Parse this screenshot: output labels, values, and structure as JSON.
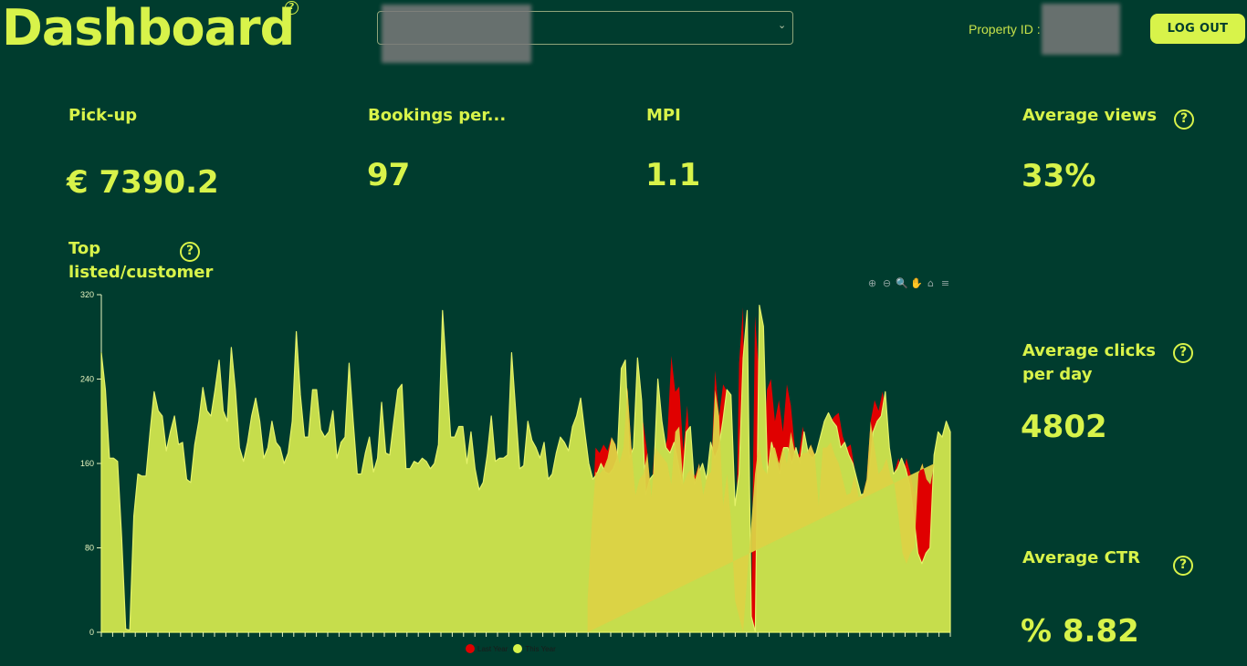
{
  "header": {
    "title": "Dashboard",
    "help_glyph": "?",
    "property_label": "Property ID :",
    "logout_label": "LOG OUT"
  },
  "kpis": [
    {
      "label": "Pick-up",
      "value": "€ 7390.2"
    },
    {
      "label": "Bookings per...",
      "value": "97"
    },
    {
      "label": "MPI",
      "value": "1.1"
    },
    {
      "label": "Average views",
      "value": "33%"
    },
    {
      "label": "Average clicks per day",
      "value": "4802"
    },
    {
      "label": "Average CTR",
      "value": "% 8.82"
    }
  ],
  "chart_title": "Top listed/customer",
  "toolbar": {
    "icons": [
      "zoom-in-icon",
      "zoom-out-icon",
      "zoom-selection-icon",
      "pan-hand-icon",
      "home-icon",
      "menu-icon"
    ]
  },
  "colors": {
    "background": "#003c2e",
    "accent": "#d8f34a",
    "last_year": "#e00000",
    "this_year": "#c6dd4c"
  },
  "chart_data": {
    "type": "area",
    "ylim": [
      0,
      320
    ],
    "yticks": [
      "0",
      "80",
      "160",
      "240",
      "320"
    ],
    "series": [
      {
        "name": "Last Year",
        "color": "#e00000",
        "values": [
          0,
          0,
          0,
          0,
          0,
          0,
          0,
          0,
          0,
          0,
          0,
          0,
          0,
          0,
          0,
          0,
          0,
          0,
          0,
          0,
          0,
          0,
          0,
          0,
          0,
          0,
          0,
          0,
          0,
          0,
          0,
          0,
          0,
          0,
          0,
          0,
          0,
          0,
          0,
          0,
          0,
          0,
          0,
          0,
          0,
          0,
          0,
          0,
          0,
          0,
          0,
          0,
          0,
          0,
          0,
          0,
          0,
          0,
          0,
          0,
          0,
          0,
          0,
          0,
          0,
          0,
          0,
          0,
          0,
          0,
          0,
          0,
          0,
          0,
          0,
          0,
          0,
          0,
          0,
          0,
          0,
          0,
          0,
          0,
          0,
          0,
          0,
          0,
          0,
          0,
          0,
          0,
          0,
          0,
          0,
          0,
          0,
          0,
          0,
          0,
          0,
          0,
          0,
          0,
          0,
          0,
          0,
          0,
          0,
          0,
          0,
          0,
          0,
          0,
          0,
          0,
          0,
          0,
          0,
          0,
          0,
          0,
          30,
          100,
          175,
          170,
          178,
          172,
          185,
          178,
          160,
          195,
          232,
          175,
          160,
          212,
          198,
          170,
          128,
          190,
          218,
          165,
          185,
          262,
          228,
          233,
          172,
          215,
          155,
          148,
          160,
          130,
          148,
          152,
          248,
          205,
          235,
          228,
          105,
          30,
          255,
          308,
          0,
          0,
          300,
          245,
          155,
          230,
          240,
          200,
          220,
          190,
          235,
          215,
          175,
          168,
          195,
          170,
          178,
          168,
          120,
          175,
          192,
          200,
          205,
          208,
          186,
          175,
          178,
          155,
          128,
          130,
          145,
          200,
          220,
          210,
          228,
          205,
          148,
          152,
          165,
          148,
          165,
          150,
          130,
          150,
          160,
          145,
          140,
          160,
          150,
          155,
          185,
          190
        ]
      },
      {
        "name": "This Year",
        "color": "#c6dd4c",
        "values": [
          265,
          230,
          165,
          165,
          162,
          90,
          3,
          2,
          110,
          150,
          148,
          148,
          190,
          228,
          210,
          205,
          172,
          190,
          205,
          178,
          180,
          145,
          142,
          178,
          200,
          232,
          210,
          205,
          230,
          258,
          210,
          200,
          270,
          230,
          175,
          162,
          180,
          205,
          222,
          200,
          165,
          175,
          200,
          180,
          175,
          160,
          170,
          200,
          285,
          225,
          185,
          185,
          230,
          230,
          192,
          185,
          190,
          210,
          165,
          180,
          185,
          255,
          200,
          150,
          150,
          170,
          185,
          152,
          165,
          218,
          170,
          168,
          200,
          230,
          235,
          155,
          155,
          162,
          160,
          165,
          162,
          155,
          160,
          178,
          305,
          245,
          185,
          185,
          195,
          195,
          160,
          190,
          155,
          135,
          142,
          168,
          205,
          162,
          165,
          165,
          168,
          265,
          210,
          155,
          158,
          200,
          182,
          175,
          165,
          180,
          145,
          150,
          170,
          185,
          180,
          172,
          195,
          205,
          222,
          190,
          160,
          145,
          150,
          160,
          152,
          150,
          155,
          165,
          250,
          258,
          165,
          175,
          260,
          220,
          130,
          145,
          150,
          240,
          200,
          175,
          170,
          180,
          160,
          140,
          190,
          195,
          140,
          150,
          160,
          145,
          180,
          165,
          175,
          200,
          230,
          225,
          120,
          150,
          260,
          305,
          15,
          0,
          310,
          290,
          150,
          180,
          165,
          150,
          175,
          175,
          160,
          175,
          160,
          190,
          170,
          165,
          170,
          185,
          200,
          208,
          200,
          195,
          175,
          180,
          168,
          160,
          145,
          130,
          132,
          150,
          190,
          200,
          205,
          228,
          175,
          150,
          155,
          165,
          155,
          140,
          110,
          75,
          65,
          75,
          80,
          168,
          190,
          185,
          200,
          190
        ]
      }
    ]
  }
}
